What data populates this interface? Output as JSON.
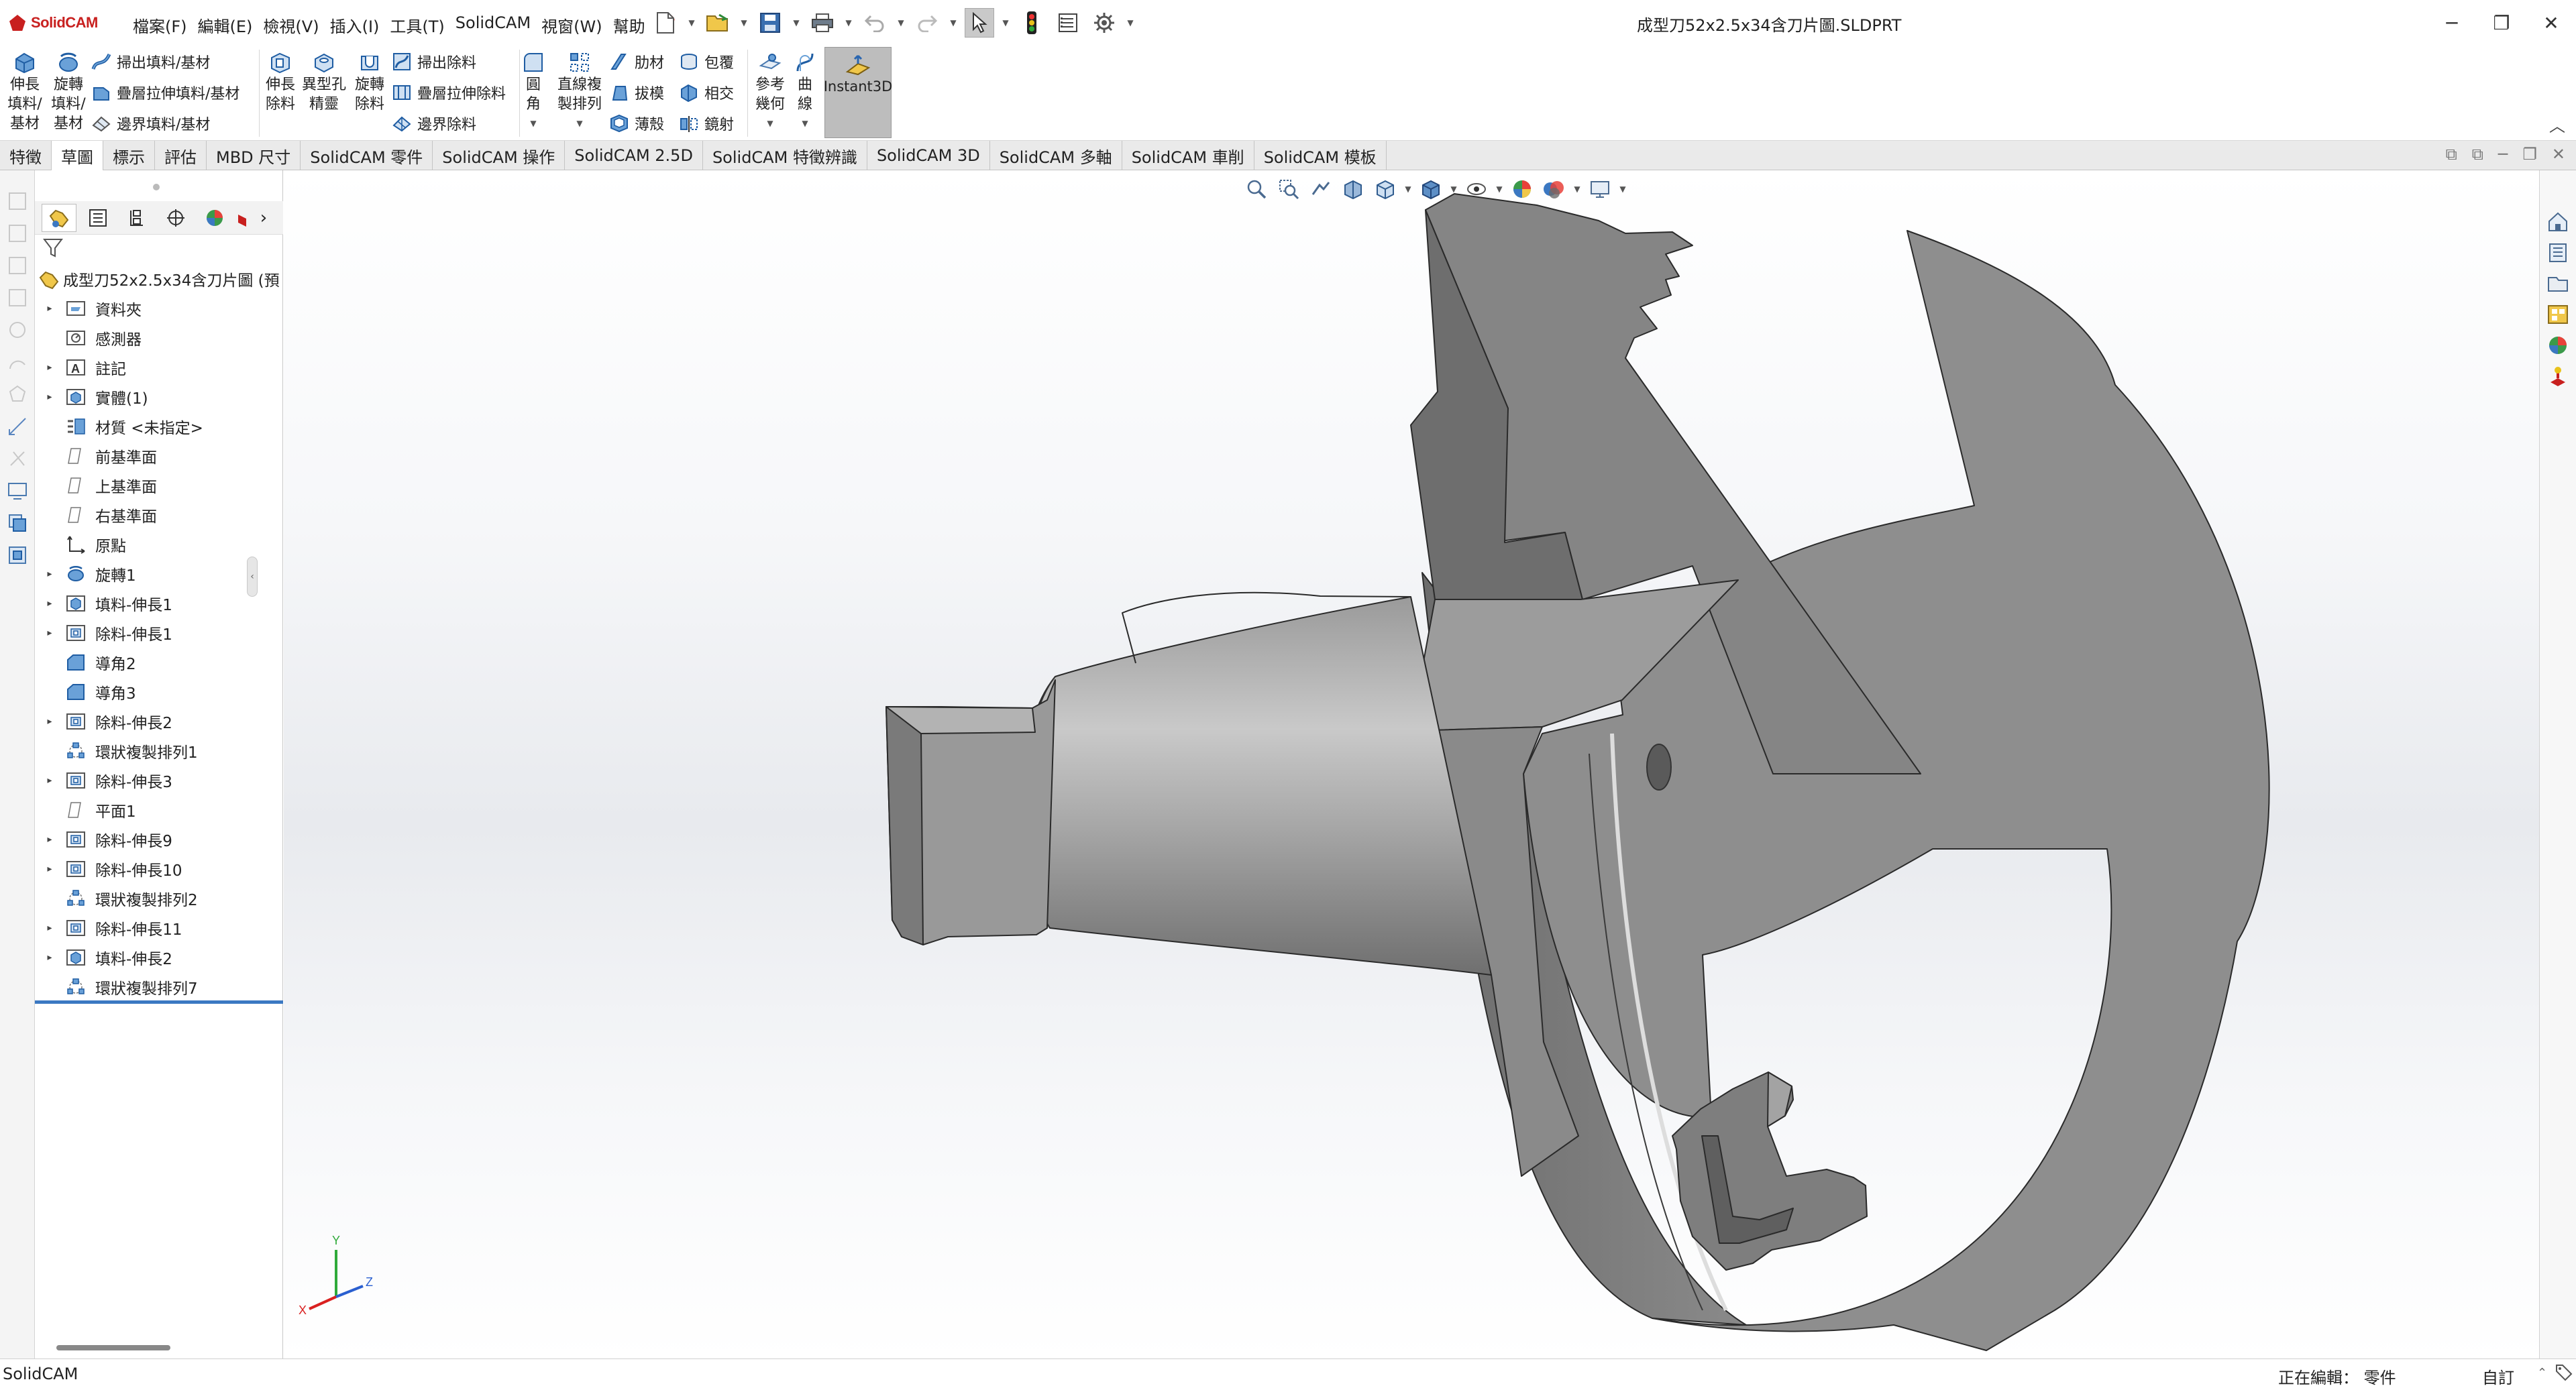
{
  "app": {
    "logo_text": "SolidCAM",
    "document_title": "成型刀52x2.5x34含刀片圖.SLDPRT",
    "menu": [
      "檔案(F)",
      "編輯(E)",
      "檢視(V)",
      "插入(I)",
      "工具(T)",
      "SolidCAM",
      "視窗(W)",
      "幫助"
    ],
    "pin_icon": "pin-icon",
    "window_controls": [
      "minimize",
      "restore",
      "close"
    ]
  },
  "quick_access": [
    "new-file-icon",
    "open-file-icon",
    "save-icon",
    "print-icon",
    "undo-icon",
    "redo-icon",
    "select-icon",
    "rebuild-icon",
    "file-properties-icon",
    "options-icon"
  ],
  "ribbon": {
    "extrude_boss": "伸長\n填料/\n基材",
    "revolve_boss": "旋轉\n填料/\n基材",
    "swept_boss": "掃出填料/基材",
    "lofted_boss": "疊層拉伸填料/基材",
    "boundary_boss": "邊界填料/基材",
    "extrude_cut": "伸長\n除料",
    "hole_wizard": "異型孔\n精靈",
    "revolve_cut": "旋轉\n除料",
    "swept_cut": "掃出除料",
    "lofted_cut": "疊層拉伸除料",
    "boundary_cut": "邊界除料",
    "fillet": "圓\n角",
    "linear_pattern": "直線複\n製排列",
    "rib": "肋材",
    "draft": "拔模",
    "shell": "薄殼",
    "wrap": "包覆",
    "intersect": "相交",
    "mirror": "鏡射",
    "ref_geometry": "參考\n幾何",
    "curves": "曲\n線",
    "instant3d": "Instant3D"
  },
  "tabs": [
    "特徵",
    "草圖",
    "標示",
    "評估",
    "MBD 尺寸",
    "SolidCAM 零件",
    "SolidCAM 操作",
    "SolidCAM 2.5D",
    "SolidCAM 特徵辨識",
    "SolidCAM 3D",
    "SolidCAM 多軸",
    "SolidCAM 車削",
    "SolidCAM 模板"
  ],
  "active_tab_index": 1,
  "feature_tree": {
    "root": "成型刀52x2.5x34含刀片圖 (預",
    "nodes": [
      {
        "label": "資料夾",
        "icon": "folder-icon",
        "expand": true
      },
      {
        "label": "感測器",
        "icon": "sensor-icon",
        "expand": false
      },
      {
        "label": "註記",
        "icon": "annotation-icon",
        "expand": true
      },
      {
        "label": "實體(1)",
        "icon": "solid-bodies-icon",
        "expand": true
      },
      {
        "label": "材質 <未指定>",
        "icon": "material-icon",
        "expand": false
      },
      {
        "label": "前基準面",
        "icon": "plane-icon",
        "expand": false
      },
      {
        "label": "上基準面",
        "icon": "plane-icon",
        "expand": false
      },
      {
        "label": "右基準面",
        "icon": "plane-icon",
        "expand": false
      },
      {
        "label": "原點",
        "icon": "origin-icon",
        "expand": false
      },
      {
        "label": "旋轉1",
        "icon": "revolve-icon",
        "expand": true
      },
      {
        "label": "填料-伸長1",
        "icon": "extrude-boss-icon",
        "expand": true
      },
      {
        "label": "除料-伸長1",
        "icon": "extrude-cut-icon",
        "expand": true
      },
      {
        "label": "導角2",
        "icon": "chamfer-icon",
        "expand": false
      },
      {
        "label": "導角3",
        "icon": "chamfer-icon",
        "expand": false
      },
      {
        "label": "除料-伸長2",
        "icon": "extrude-cut-icon",
        "expand": true
      },
      {
        "label": "環狀複製排列1",
        "icon": "circular-pattern-icon",
        "expand": false
      },
      {
        "label": "除料-伸長3",
        "icon": "extrude-cut-icon",
        "expand": true
      },
      {
        "label": "平面1",
        "icon": "plane-icon",
        "expand": false
      },
      {
        "label": "除料-伸長9",
        "icon": "extrude-cut-icon",
        "expand": true
      },
      {
        "label": "除料-伸長10",
        "icon": "extrude-cut-icon",
        "expand": true
      },
      {
        "label": "環狀複製排列2",
        "icon": "circular-pattern-icon",
        "expand": false
      },
      {
        "label": "除料-伸長11",
        "icon": "extrude-cut-icon",
        "expand": true
      },
      {
        "label": "填料-伸長2",
        "icon": "extrude-boss-icon",
        "expand": true
      },
      {
        "label": "環狀複製排列7",
        "icon": "circular-pattern-icon",
        "expand": false
      }
    ]
  },
  "triad": {
    "x": "X",
    "y": "Y",
    "z": "Z"
  },
  "status": {
    "left": "SolidCAM",
    "editing": "正在編輯： 零件",
    "units": "自訂",
    "scale_icon": "scale-icon",
    "tag_icon": "tag-icon"
  },
  "colors": {
    "accent_blue": "#3b78c2",
    "logo_red": "#c8201f",
    "part_gray": "#8e8e8e"
  }
}
